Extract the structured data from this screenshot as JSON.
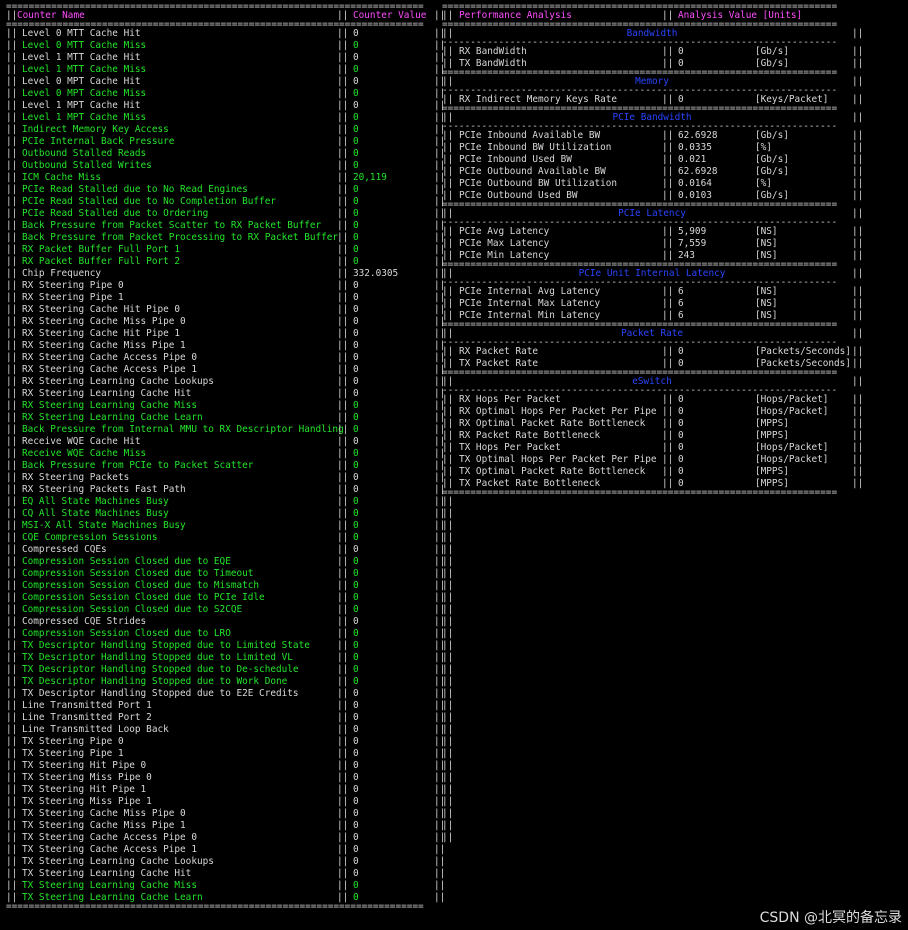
{
  "left_header": {
    "col1": "Counter Name",
    "col2": "Counter Value"
  },
  "right_header": {
    "col1": "Performance Analysis",
    "col2": "Analysis Value [Units]"
  },
  "counters": [
    {
      "name": "Level 0 MTT Cache Hit",
      "value": "0",
      "color": "w"
    },
    {
      "name": "Level 0 MTT Cache Miss",
      "value": "0",
      "color": "g"
    },
    {
      "name": "Level 1 MTT Cache Hit",
      "value": "0",
      "color": "w"
    },
    {
      "name": "Level 1 MTT Cache Miss",
      "value": "0",
      "color": "g"
    },
    {
      "name": "Level 0 MPT Cache Hit",
      "value": "0",
      "color": "w"
    },
    {
      "name": "Level 0 MPT Cache Miss",
      "value": "0",
      "color": "g"
    },
    {
      "name": "Level 1 MPT Cache Hit",
      "value": "0",
      "color": "w"
    },
    {
      "name": "Level 1 MPT Cache Miss",
      "value": "0",
      "color": "g"
    },
    {
      "name": "Indirect Memory Key Access",
      "value": "0",
      "color": "g"
    },
    {
      "name": "PCIe Internal Back Pressure",
      "value": "0",
      "color": "g"
    },
    {
      "name": "Outbound Stalled Reads",
      "value": "0",
      "color": "g"
    },
    {
      "name": "Outbound Stalled Writes",
      "value": "0",
      "color": "g"
    },
    {
      "name": "ICM Cache Miss",
      "value": "20,119",
      "color": "g"
    },
    {
      "name": "PCIe Read Stalled due to No Read Engines",
      "value": "0",
      "color": "g"
    },
    {
      "name": "PCIe Read Stalled due to No Completion Buffer",
      "value": "0",
      "color": "g"
    },
    {
      "name": "PCIe Read Stalled due to Ordering",
      "value": "0",
      "color": "g"
    },
    {
      "name": "Back Pressure from Packet Scatter to RX Packet Buffer",
      "value": "0",
      "color": "g"
    },
    {
      "name": "Back Pressure from Packet Processing to RX Packet Buffer",
      "value": "0",
      "color": "g"
    },
    {
      "name": "RX Packet Buffer Full Port 1",
      "value": "0",
      "color": "g"
    },
    {
      "name": "RX Packet Buffer Full Port 2",
      "value": "0",
      "color": "g"
    },
    {
      "name": "Chip Frequency",
      "value": "332.0305",
      "color": "w"
    },
    {
      "name": "RX Steering Pipe 0",
      "value": "0",
      "color": "w"
    },
    {
      "name": "RX Steering Pipe 1",
      "value": "0",
      "color": "w"
    },
    {
      "name": "RX Steering Cache Hit Pipe 0",
      "value": "0",
      "color": "w"
    },
    {
      "name": "RX Steering Cache Miss Pipe 0",
      "value": "0",
      "color": "w"
    },
    {
      "name": "RX Steering Cache Hit Pipe 1",
      "value": "0",
      "color": "w"
    },
    {
      "name": "RX Steering Cache Miss Pipe 1",
      "value": "0",
      "color": "w"
    },
    {
      "name": "RX Steering Cache Access Pipe 0",
      "value": "0",
      "color": "w"
    },
    {
      "name": "RX Steering Cache Access Pipe 1",
      "value": "0",
      "color": "w"
    },
    {
      "name": "RX Steering Learning Cache Lookups",
      "value": "0",
      "color": "w"
    },
    {
      "name": "RX Steering Learning Cache Hit",
      "value": "0",
      "color": "w"
    },
    {
      "name": "RX Steering Learning Cache Miss",
      "value": "0",
      "color": "g"
    },
    {
      "name": "RX Steering Learning Cache Learn",
      "value": "0",
      "color": "g"
    },
    {
      "name": "Back Pressure from Internal MMU to RX Descriptor Handling",
      "value": "0",
      "color": "g"
    },
    {
      "name": "Receive WQE Cache Hit",
      "value": "0",
      "color": "w"
    },
    {
      "name": "Receive WQE Cache Miss",
      "value": "0",
      "color": "g"
    },
    {
      "name": "Back Pressure from PCIe to Packet Scatter",
      "value": "0",
      "color": "g"
    },
    {
      "name": "RX Steering Packets",
      "value": "0",
      "color": "w"
    },
    {
      "name": "RX Steering Packets Fast Path",
      "value": "0",
      "color": "w"
    },
    {
      "name": "EQ All State Machines Busy",
      "value": "0",
      "color": "g"
    },
    {
      "name": "CQ All State Machines Busy",
      "value": "0",
      "color": "g"
    },
    {
      "name": "MSI-X All State Machines Busy",
      "value": "0",
      "color": "g"
    },
    {
      "name": "CQE Compression Sessions",
      "value": "0",
      "color": "g"
    },
    {
      "name": "Compressed CQEs",
      "value": "0",
      "color": "w"
    },
    {
      "name": "Compression Session Closed due to EQE",
      "value": "0",
      "color": "g"
    },
    {
      "name": "Compression Session Closed due to Timeout",
      "value": "0",
      "color": "g"
    },
    {
      "name": "Compression Session Closed due to Mismatch",
      "value": "0",
      "color": "g"
    },
    {
      "name": "Compression Session Closed due to PCIe Idle",
      "value": "0",
      "color": "g"
    },
    {
      "name": "Compression Session Closed due to S2CQE",
      "value": "0",
      "color": "g"
    },
    {
      "name": "Compressed CQE Strides",
      "value": "0",
      "color": "w"
    },
    {
      "name": "Compression Session Closed due to LRO",
      "value": "0",
      "color": "g"
    },
    {
      "name": "TX Descriptor Handling Stopped due to Limited State",
      "value": "0",
      "color": "g"
    },
    {
      "name": "TX Descriptor Handling Stopped due to Limited VL",
      "value": "0",
      "color": "g"
    },
    {
      "name": "TX Descriptor Handling Stopped due to De-schedule",
      "value": "0",
      "color": "g"
    },
    {
      "name": "TX Descriptor Handling Stopped due to Work Done",
      "value": "0",
      "color": "g"
    },
    {
      "name": "TX Descriptor Handling Stopped due to E2E Credits",
      "value": "0",
      "color": "w"
    },
    {
      "name": "Line Transmitted Port 1",
      "value": "0",
      "color": "w"
    },
    {
      "name": "Line Transmitted Port 2",
      "value": "0",
      "color": "w"
    },
    {
      "name": "Line Transmitted Loop Back",
      "value": "0",
      "color": "w"
    },
    {
      "name": "TX Steering Pipe 0",
      "value": "0",
      "color": "w"
    },
    {
      "name": "TX Steering Pipe 1",
      "value": "0",
      "color": "w"
    },
    {
      "name": "TX Steering Hit Pipe 0",
      "value": "0",
      "color": "w"
    },
    {
      "name": "TX Steering Miss Pipe 0",
      "value": "0",
      "color": "w"
    },
    {
      "name": "TX Steering Hit Pipe 1",
      "value": "0",
      "color": "w"
    },
    {
      "name": "TX Steering Miss Pipe 1",
      "value": "0",
      "color": "w"
    },
    {
      "name": "TX Steering Cache Miss Pipe 0",
      "value": "0",
      "color": "w"
    },
    {
      "name": "TX Steering Cache Miss Pipe 1",
      "value": "0",
      "color": "w"
    },
    {
      "name": "TX Steering Cache Access Pipe 0",
      "value": "0",
      "color": "w"
    },
    {
      "name": "TX Steering Cache Access Pipe 1",
      "value": "0",
      "color": "w"
    },
    {
      "name": "TX Steering Learning Cache Lookups",
      "value": "0",
      "color": "w"
    },
    {
      "name": "TX Steering Learning Cache Hit",
      "value": "0",
      "color": "w"
    },
    {
      "name": "TX Steering Learning Cache Miss",
      "value": "0",
      "color": "g"
    },
    {
      "name": "TX Steering Learning Cache Learn",
      "value": "0",
      "color": "g"
    }
  ],
  "sections": [
    {
      "title": "Bandwidth",
      "rows": [
        {
          "name": "RX BandWidth",
          "value": "0",
          "unit": "[Gb/s]"
        },
        {
          "name": "TX BandWidth",
          "value": "0",
          "unit": "[Gb/s]"
        }
      ]
    },
    {
      "title": "Memory",
      "rows": [
        {
          "name": "RX Indirect Memory Keys Rate",
          "value": "0",
          "unit": "[Keys/Packet]"
        }
      ]
    },
    {
      "title": "PCIe Bandwidth",
      "rows": [
        {
          "name": "PCIe Inbound Available BW",
          "value": "62.6928",
          "unit": "[Gb/s]"
        },
        {
          "name": "PCIe Inbound BW Utilization",
          "value": "0.0335",
          "unit": "[%]"
        },
        {
          "name": "PCIe Inbound Used BW",
          "value": "0.021",
          "unit": "[Gb/s]"
        },
        {
          "name": "PCIe Outbound Available BW",
          "value": "62.6928",
          "unit": "[Gb/s]"
        },
        {
          "name": "PCIe Outbound BW Utilization",
          "value": "0.0164",
          "unit": "[%]"
        },
        {
          "name": "PCIe Outbound Used BW",
          "value": "0.0103",
          "unit": "[Gb/s]"
        }
      ]
    },
    {
      "title": "PCIe Latency",
      "rows": [
        {
          "name": "PCIe Avg Latency",
          "value": "5,909",
          "unit": "[NS]"
        },
        {
          "name": "PCIe Max Latency",
          "value": "7,559",
          "unit": "[NS]"
        },
        {
          "name": "PCIe Min Latency",
          "value": "243",
          "unit": "[NS]"
        }
      ]
    },
    {
      "title": "PCIe Unit Internal Latency",
      "rows": [
        {
          "name": "PCIe Internal Avg Latency",
          "value": "6",
          "unit": "[NS]"
        },
        {
          "name": "PCIe Internal Max Latency",
          "value": "6",
          "unit": "[NS]"
        },
        {
          "name": "PCIe Internal Min Latency",
          "value": "6",
          "unit": "[NS]"
        }
      ]
    },
    {
      "title": "Packet Rate",
      "rows": [
        {
          "name": "RX Packet Rate",
          "value": "0",
          "unit": "[Packets/Seconds]"
        },
        {
          "name": "TX Packet Rate",
          "value": "0",
          "unit": "[Packets/Seconds]"
        }
      ]
    },
    {
      "title": "eSwitch",
      "rows": [
        {
          "name": "RX Hops Per Packet",
          "value": "0",
          "unit": "[Hops/Packet]"
        },
        {
          "name": "RX Optimal Hops Per Packet Per Pipe",
          "value": "0",
          "unit": "[Hops/Packet]"
        },
        {
          "name": "RX Optimal Packet Rate Bottleneck",
          "value": "0",
          "unit": "[MPPS]"
        },
        {
          "name": "RX Packet Rate Bottleneck",
          "value": "0",
          "unit": "[MPPS]"
        },
        {
          "name": "TX Hops Per Packet",
          "value": "0",
          "unit": "[Hops/Packet]"
        },
        {
          "name": "TX Optimal Hops Per Packet Per Pipe",
          "value": "0",
          "unit": "[Hops/Packet]"
        },
        {
          "name": "TX Optimal Packet Rate Bottleneck",
          "value": "0",
          "unit": "[MPPS]"
        },
        {
          "name": "TX Packet Rate Bottleneck",
          "value": "0",
          "unit": "[MPPS]"
        }
      ]
    }
  ],
  "watermark": "CSDN @北冥的备忘录",
  "colors": {
    "background": "#000000",
    "header": "#ff4dff",
    "green": "#23e52a",
    "section": "#2a44ff",
    "text": "#d8d8d8"
  }
}
